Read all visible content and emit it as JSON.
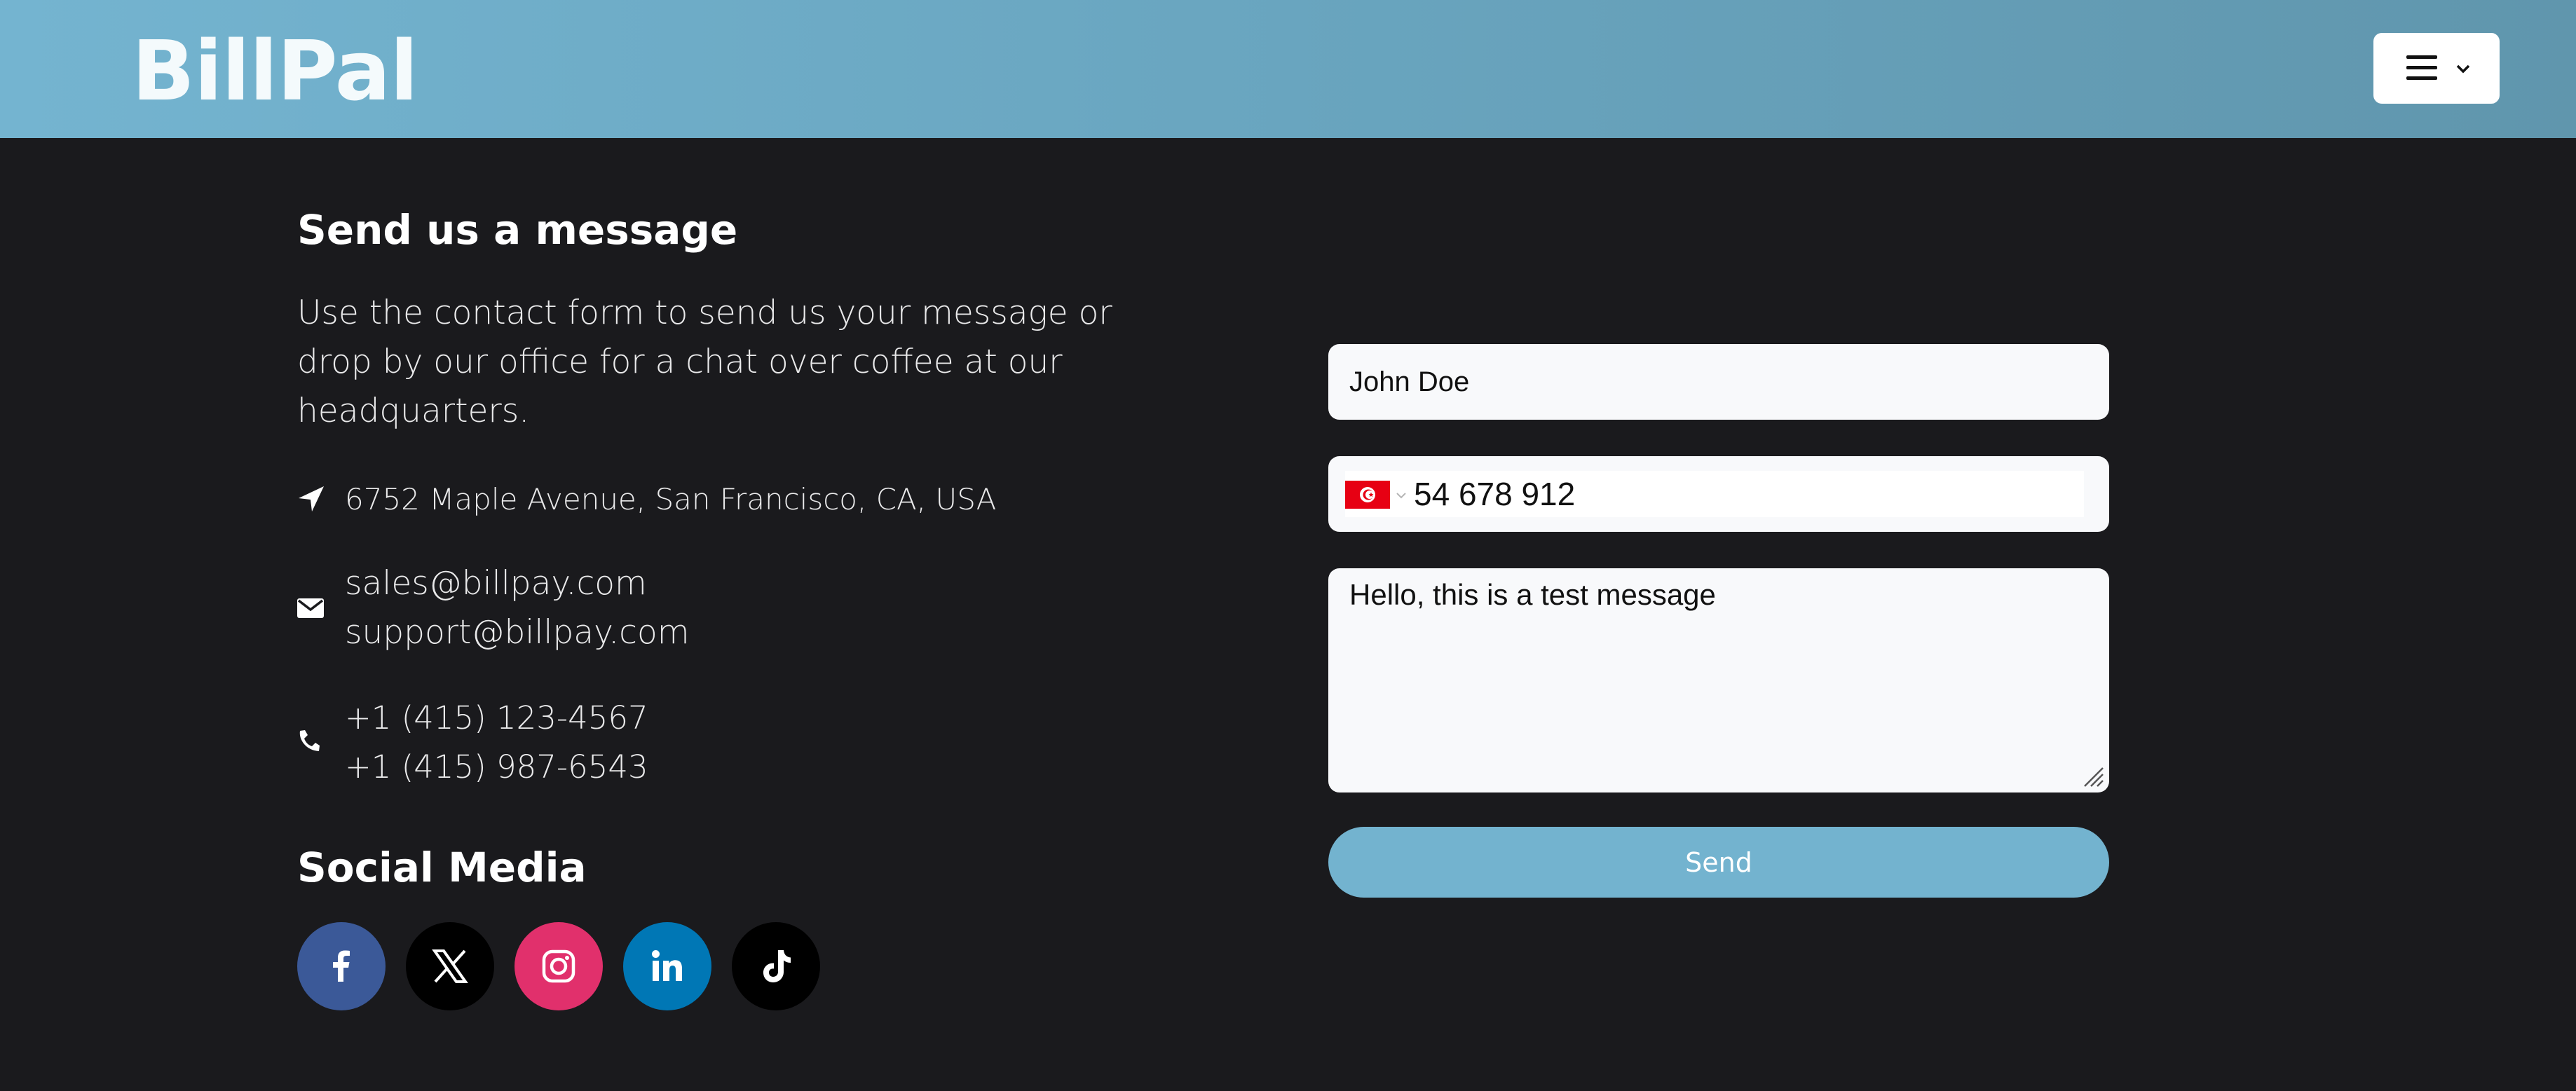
{
  "header": {
    "brand": "BillPal",
    "menu_icon": "hamburger-icon",
    "menu_chevron_icon": "chevron-down-icon",
    "gradient_colors": [
      "#74b4d0",
      "#6096ad"
    ]
  },
  "contact": {
    "title": "Send us a message",
    "intro": "Use the contact form to send us your message or drop by our office for a chat over coffee at our headquarters.",
    "address_icon": "location-arrow-icon",
    "address": "6752 Maple Avenue, San Francisco, CA, USA",
    "email_icon": "envelope-icon",
    "emails": [
      "sales@billpay.com",
      "support@billpay.com"
    ],
    "phone_icon": "phone-icon",
    "phones": [
      "+1 (415) 123-4567",
      "+1 (415) 987-6543"
    ]
  },
  "social": {
    "title": "Social Media",
    "links": [
      {
        "name": "facebook",
        "icon": "facebook-icon",
        "color": "#3b5998"
      },
      {
        "name": "x",
        "icon": "x-icon",
        "color": "#000000"
      },
      {
        "name": "instagram",
        "icon": "instagram-icon",
        "color": "#e1306c"
      },
      {
        "name": "linkedin",
        "icon": "linkedin-icon",
        "color": "#0077b5"
      },
      {
        "name": "tiktok",
        "icon": "tiktok-icon",
        "color": "#000000"
      }
    ]
  },
  "form": {
    "name_value": "John Doe",
    "phone_country_flag": "tunisia-flag-icon",
    "phone_value": "54 678 912",
    "message_value": "Hello, this is a test message",
    "send_label": "Send",
    "send_color": "#73b3cf"
  },
  "colors": {
    "background": "#1a1a1d",
    "field_background": "#f8f9fb"
  }
}
